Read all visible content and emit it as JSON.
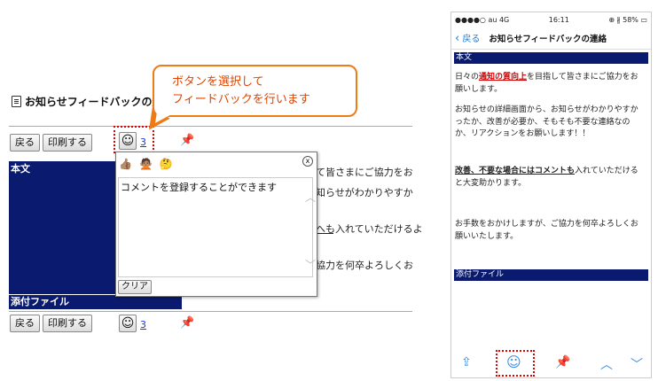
{
  "left": {
    "title": "お知らせフィードバックの連",
    "back_label": "戻る",
    "print_label": "印刷する",
    "feedback_count": "3",
    "body_header": "本文",
    "attachments_header": "添付ファイル",
    "bg_lines": [
      "て皆さまにご協力をお",
      "知らせがわかりやすか",
      "へも入れていただけるよ",
      "協力を何卒よろしくお"
    ],
    "bg_underlined": "へも"
  },
  "callout": {
    "line1": "ボタンを選択して",
    "line2": "フィードバックを行います"
  },
  "popup": {
    "close": "x",
    "emojis": [
      "👍🏽",
      "🙅🏽",
      "🤔"
    ],
    "textarea_value": "コメントを登録することができます",
    "clear_label": "クリア"
  },
  "phone": {
    "status": {
      "carrier": "●●●●○ au  4G",
      "time": "16:11",
      "battery": "⊕ ∦ 58% ▭"
    },
    "back_label": "戻る",
    "nav_title": "お知らせフィードバックの連絡",
    "body_header": "本文",
    "p1_a": "日々の",
    "p1_red": "通知の質向上",
    "p1_b": "を目指して皆さまにご協力をお願いします。",
    "p2": "お知らせの詳細画面から、お知らせがわかりやすかったか、改善が必要か、そもそも不要な連絡なのか、リアクションをお願いします！！",
    "p3_bold": "改善、不要な場合にはコメントも",
    "p3_rest": "入れていただけると大変助かります。",
    "p4": "お手数をおかけしますが、ご協力を何卒よろしくお願いいたします。",
    "attachments_header": "添付ファイル"
  },
  "colors": {
    "navy": "#0a1a6e",
    "callout": "#f07a14",
    "highlight": "#e00000",
    "link": "#1a3bd1",
    "ios_blue": "#3a8ee6"
  }
}
